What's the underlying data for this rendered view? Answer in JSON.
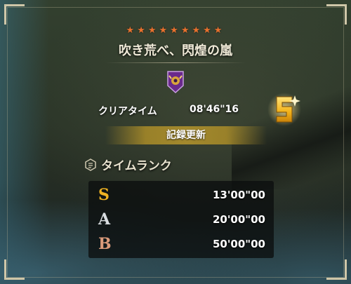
{
  "quest": {
    "stars": "★★★★★★★★★",
    "title": "吹き荒べ、閃煌の嵐",
    "monster_icon": "monster-emblem-icon"
  },
  "result": {
    "clear_label": "クリアタイム",
    "clear_time": "08'46\"16",
    "achieved_rank": "S",
    "record_text": "記録更新"
  },
  "time_rank": {
    "heading": "タイムランク",
    "heading_icon": "rank-emblem-icon",
    "rows": [
      {
        "rank": "S",
        "time": "13'00\"00",
        "color": "#f0b323"
      },
      {
        "rank": "A",
        "time": "20'00\"00",
        "color": "#d9dde0"
      },
      {
        "rank": "B",
        "time": "50'00\"00",
        "color": "#d99a7a"
      }
    ]
  },
  "colors": {
    "star": "#e8712e",
    "gold_badge": "#f2b21a",
    "banner": "#b08f2b"
  }
}
